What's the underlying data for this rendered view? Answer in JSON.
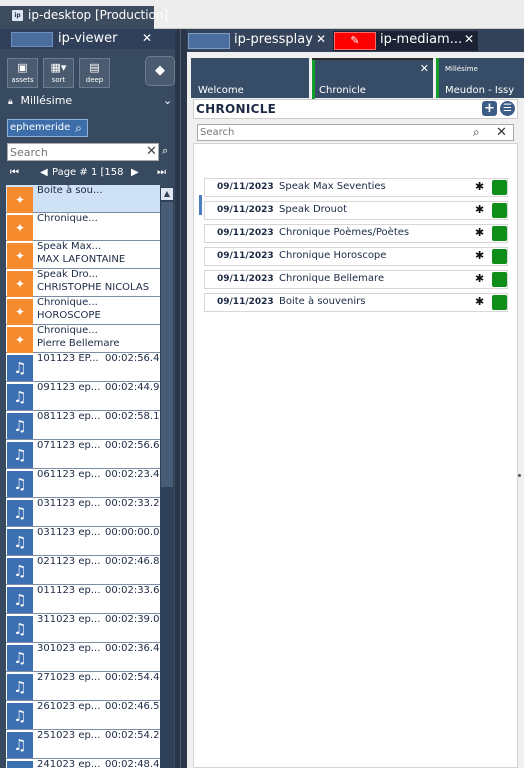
{
  "window": {
    "title": "ip-desktop [Production]",
    "app_icon": "ip"
  },
  "left_panel": {
    "tab_label": "ip-viewer",
    "toolbar": [
      {
        "icon": "image-icon",
        "label": "assets"
      },
      {
        "icon": "calendar-sort-icon",
        "label": "sort"
      },
      {
        "icon": "deep-icon",
        "label": "deep"
      }
    ],
    "tag_icon": "tag-icon",
    "collection": "Millésime",
    "filter_tag": "ephemeride",
    "search_placeholder": "Search",
    "pager": {
      "first": "⏮",
      "prev": "◀",
      "text": "Page # 1 [158",
      "next": "▶",
      "last": "⏭"
    },
    "items": [
      {
        "type": "pin",
        "line1": "Boite à sou...",
        "line2": "",
        "duration": "",
        "selected": true
      },
      {
        "type": "pin",
        "line1": "Chronique...",
        "line2": "",
        "duration": ""
      },
      {
        "type": "pin",
        "line1": "Speak Max...",
        "line2": "MAX LAFONTAINE",
        "duration": ""
      },
      {
        "type": "pin",
        "line1": "Speak Dro...",
        "line2": "CHRISTOPHE NICOLAS",
        "duration": ""
      },
      {
        "type": "pin",
        "line1": "Chronique...",
        "line2": "HOROSCOPE",
        "duration": ""
      },
      {
        "type": "pin",
        "line1": "Chronique...",
        "line2": "Pierre Bellemare",
        "duration": ""
      },
      {
        "type": "note",
        "line1": "101123 EP...",
        "line2": "",
        "duration": "00:02:56.4"
      },
      {
        "type": "note",
        "line1": "091123 ep...",
        "line2": "",
        "duration": "00:02:44.9"
      },
      {
        "type": "note",
        "line1": "081123 ep...",
        "line2": "",
        "duration": "00:02:58.1"
      },
      {
        "type": "note",
        "line1": "071123 ep...",
        "line2": "",
        "duration": "00:02:56.6"
      },
      {
        "type": "note",
        "line1": "061123 ep...",
        "line2": "",
        "duration": "00:02:23.4"
      },
      {
        "type": "note",
        "line1": "031123 ep...",
        "line2": "",
        "duration": "00:02:33.2"
      },
      {
        "type": "note",
        "line1": "031123 ep...",
        "line2": "",
        "duration": "00:00:00.0"
      },
      {
        "type": "note",
        "line1": "021123 ep...",
        "line2": "",
        "duration": "00:02:46.8"
      },
      {
        "type": "note",
        "line1": "011123 ep...",
        "line2": "",
        "duration": "00:02:33.6"
      },
      {
        "type": "note",
        "line1": "311023 ep...",
        "line2": "",
        "duration": "00:02:39.0"
      },
      {
        "type": "note",
        "line1": "301023 ep...",
        "line2": "",
        "duration": "00:02:36.4"
      },
      {
        "type": "note",
        "line1": "271023 ep...",
        "line2": "",
        "duration": "00:02:54.4"
      },
      {
        "type": "note",
        "line1": "261023 ep...",
        "line2": "",
        "duration": "00:02:46.5"
      },
      {
        "type": "note",
        "line1": "251023 ep...",
        "line2": "",
        "duration": "00:02:54.2"
      },
      {
        "type": "note",
        "line1": "241023 ep...",
        "line2": "",
        "duration": "00:02:48.4"
      }
    ]
  },
  "right_panel": {
    "tabs": [
      {
        "label": "ip-pressplay"
      },
      {
        "label": "ip-mediam..."
      }
    ],
    "inner_tabs": {
      "welcome": "Welcome",
      "chronicle": "Chronicle",
      "millesime_small": "Millésime",
      "millesime_label": "Meudon - Issy"
    },
    "header": "CHRONICLE",
    "search_placeholder": "Search",
    "rows": [
      {
        "date": "09/11/2023",
        "name": "Speak Max Seventies"
      },
      {
        "date": "09/11/2023",
        "name": "Speak Drouot"
      },
      {
        "date": "09/11/2023",
        "name": "Chronique Poèmes/Poètes"
      },
      {
        "date": "09/11/2023",
        "name": "Chronique Horoscope"
      },
      {
        "date": "09/11/2023",
        "name": "Chronique Bellemare"
      },
      {
        "date": "09/11/2023",
        "name": "Boite à souvenirs"
      }
    ]
  },
  "colors": {
    "accent_orange": "#f58b2c",
    "accent_blue": "#3d70b3",
    "status_green": "#0f8f1a",
    "brand_red": "#ff0000"
  }
}
